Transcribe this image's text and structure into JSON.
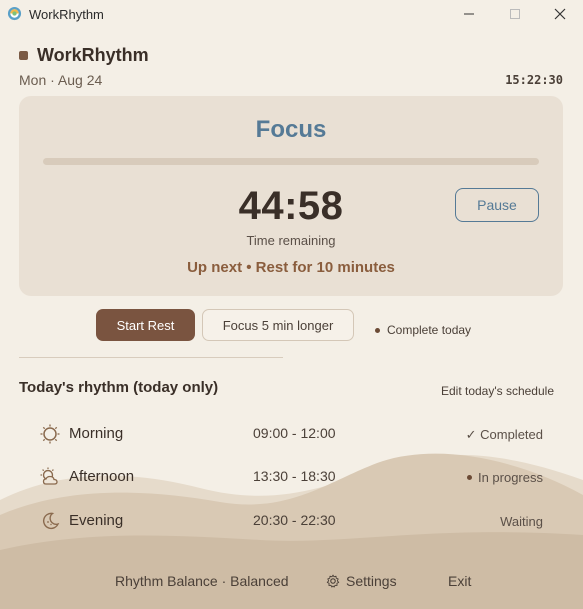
{
  "window": {
    "title": "WorkRhythm"
  },
  "header": {
    "app_name": "WorkRhythm",
    "date": "Mon · Aug 24",
    "clock": "15:22:30"
  },
  "focus": {
    "mode": "Focus",
    "time_remaining": "44:58",
    "time_label": "Time remaining",
    "up_next": "Up next • Rest for 10 minutes",
    "pause_label": "Pause",
    "progress": 0,
    "accent_color": "#557a96"
  },
  "actions": {
    "start_rest": "Start Rest",
    "focus_longer": "Focus 5 min longer",
    "complete_today": "Complete today"
  },
  "rhythm": {
    "title": "Today's rhythm (today only)",
    "edit_label": "Edit today's schedule",
    "rows": [
      {
        "icon": "sun-icon",
        "name": "Morning",
        "time": "09:00 - 12:00",
        "status": "✓ Completed"
      },
      {
        "icon": "partly-cloudy-icon",
        "name": "Afternoon",
        "time": "13:30 - 18:30",
        "status": "In progress"
      },
      {
        "icon": "moon-icon",
        "name": "Evening",
        "time": "20:30 - 22:30",
        "status": "Waiting"
      }
    ]
  },
  "footer": {
    "balance": "Rhythm Balance · Balanced",
    "settings": "Settings",
    "exit": "Exit"
  },
  "colors": {
    "background": "#f4efe6",
    "card": "#e9e0d4",
    "primary_button": "#7a5440",
    "up_next": "#8a5d3d"
  }
}
